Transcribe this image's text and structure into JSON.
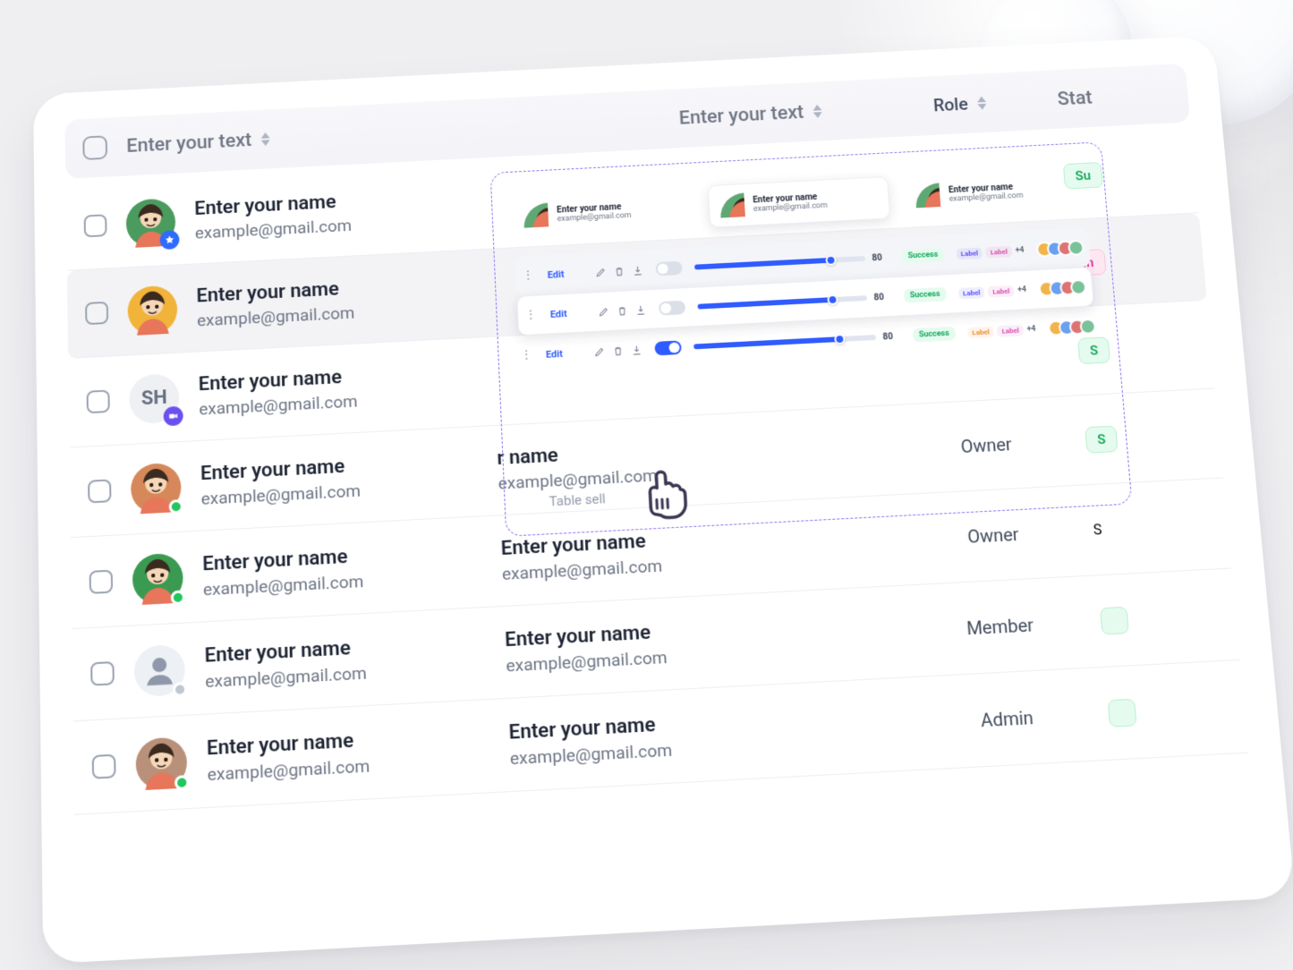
{
  "header": {
    "col1": "Enter your text",
    "col2": "Enter your text",
    "role": "Role",
    "status": "Stat"
  },
  "avatars": {
    "colors": [
      "#4b9a5e",
      "#f1b33a",
      "#f0f2f6",
      "#d6885a",
      "#3a9a52",
      "#dfe4ec",
      "#b99079"
    ],
    "initials_text": "SH"
  },
  "status_colors": {
    "online": "#22c55e",
    "away": "#c1c7d2"
  },
  "rows": [
    {
      "name": "Enter your name",
      "email": "example@gmail.com",
      "avatar_type": "img",
      "avatar_color_idx": 0,
      "badge": "star",
      "name2": null,
      "email2": null,
      "role": null,
      "status": "Su",
      "status_kind": "success",
      "selected": false
    },
    {
      "name": "Enter your name",
      "email": "example@gmail.com",
      "avatar_type": "img",
      "avatar_color_idx": 1,
      "badge": null,
      "name2": null,
      "email2": null,
      "role": null,
      "status": "In",
      "status_kind": "info",
      "selected": true
    },
    {
      "name": "Enter your name",
      "email": "example@gmail.com",
      "avatar_type": "initials",
      "avatar_color_idx": 2,
      "badge": "video",
      "name2": null,
      "email2": null,
      "role": null,
      "status": "S",
      "status_kind": "success",
      "selected": false
    },
    {
      "name": "Enter your name",
      "email": "example@gmail.com",
      "avatar_type": "img",
      "avatar_color_idx": 3,
      "badge": null,
      "status_dot": "online",
      "name2": "r name",
      "email2": "example@gmail.com",
      "role": "Owner",
      "status": "S",
      "status_kind": "success",
      "selected": false
    },
    {
      "name": "Enter your name",
      "email": "example@gmail.com",
      "avatar_type": "img",
      "avatar_color_idx": 4,
      "badge": null,
      "status_dot": "online",
      "name2": "Enter your name",
      "email2": "example@gmail.com",
      "role": "Owner",
      "status": "S",
      "status_kind": "plain",
      "selected": false
    },
    {
      "name": "Enter your name",
      "email": "example@gmail.com",
      "avatar_type": "default",
      "avatar_color_idx": 5,
      "badge": null,
      "status_dot": "away",
      "name2": "Enter your name",
      "email2": "example@gmail.com",
      "role": "Member",
      "status": "",
      "status_kind": "success",
      "selected": false
    },
    {
      "name": "Enter your name",
      "email": "example@gmail.com",
      "avatar_type": "img",
      "avatar_color_idx": 6,
      "badge": null,
      "status_dot": "online",
      "name2": "Enter your name",
      "email2": "example@gmail.com",
      "role": "Admin",
      "status": "",
      "status_kind": "success",
      "selected": false
    }
  ],
  "overlay": {
    "label": "Table sell",
    "cells": [
      {
        "name": "Enter your name",
        "email": "example@gmail.com",
        "selected": false
      },
      {
        "name": "Enter your name",
        "email": "example@gmail.com",
        "selected": true
      },
      {
        "name": "Enter your name",
        "email": "example@gmail.com",
        "selected": false
      }
    ],
    "tracks": [
      {
        "edit": "Edit",
        "toggle": false,
        "progress": 80,
        "status": "Success",
        "labels": [
          "Label",
          "Label"
        ],
        "plus": "+4",
        "tag_colors": [
          "#5a4fff",
          "#d84fb0"
        ],
        "style": "on"
      },
      {
        "edit": "Edit",
        "toggle": false,
        "progress": 80,
        "status": "Success",
        "labels": [
          "Label",
          "Label"
        ],
        "plus": "+4",
        "tag_colors": [
          "#5a4fff",
          "#d84fb0"
        ],
        "style": "sel"
      },
      {
        "edit": "Edit",
        "toggle": true,
        "progress": 80,
        "status": "Success",
        "labels": [
          "Label",
          "Label"
        ],
        "plus": "+4",
        "tag_colors": [
          "#f08b2f",
          "#d84fb0"
        ],
        "style": "plain"
      }
    ],
    "cell_colors": [
      "#5fa874",
      "#5fa874",
      "#5fa874"
    ],
    "group_colors": [
      "#f0b44a",
      "#6aa0ef",
      "#df7373",
      "#7ac29a"
    ]
  }
}
